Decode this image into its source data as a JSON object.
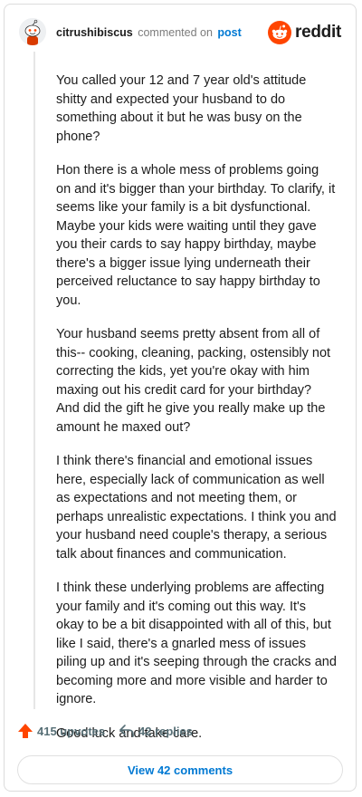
{
  "header": {
    "username": "citrushibiscus",
    "action": "commented on",
    "post_link": "post",
    "brand": "reddit"
  },
  "comment": {
    "paragraphs": [
      "You called your 12 and 7 year old's attitude shitty and expected your husband to do something about it but he was busy on the phone?",
      "Hon there is a whole mess of problems going on and it's bigger than your birthday. To clarify, it seems like your family is a bit dysfunctional. Maybe your kids were waiting until they gave you their cards to say happy birthday, maybe there's a bigger issue lying underneath their perceived reluctance to say happy birthday to you.",
      "Your husband seems pretty absent from all of this-- cooking, cleaning, packing, ostensibly not correcting the kids, yet you're okay with him maxing out his credit card for your birthday? And did the gift he give you really make up the amount he maxed out?",
      "I think there's financial and emotional issues here, especially lack of communication as well as expectations and not meeting them, or perhaps unrealistic expectations. I think you and your husband need couple's therapy, a serious talk about finances and communication.",
      "I think these underlying problems are affecting your family and it's coming out this way. It's okay to be a bit disappointed with all of this, but like I said, there's a gnarled mess of issues piling up and it's seeping through the cracks and becoming more and more visible and harder to ignore.",
      "Good luck and take care."
    ]
  },
  "footer": {
    "upvotes": "415 upvotes",
    "replies": "42 replies",
    "view_comments": "View 42 comments"
  },
  "colors": {
    "accent": "#ff4500",
    "link": "#0079d3",
    "muted": "#576f76"
  },
  "icons": {
    "upvote": "upvote-arrow-icon",
    "reply": "reply-arrow-icon",
    "brand": "reddit-alien-icon",
    "avatar": "snoo-avatar-icon"
  }
}
